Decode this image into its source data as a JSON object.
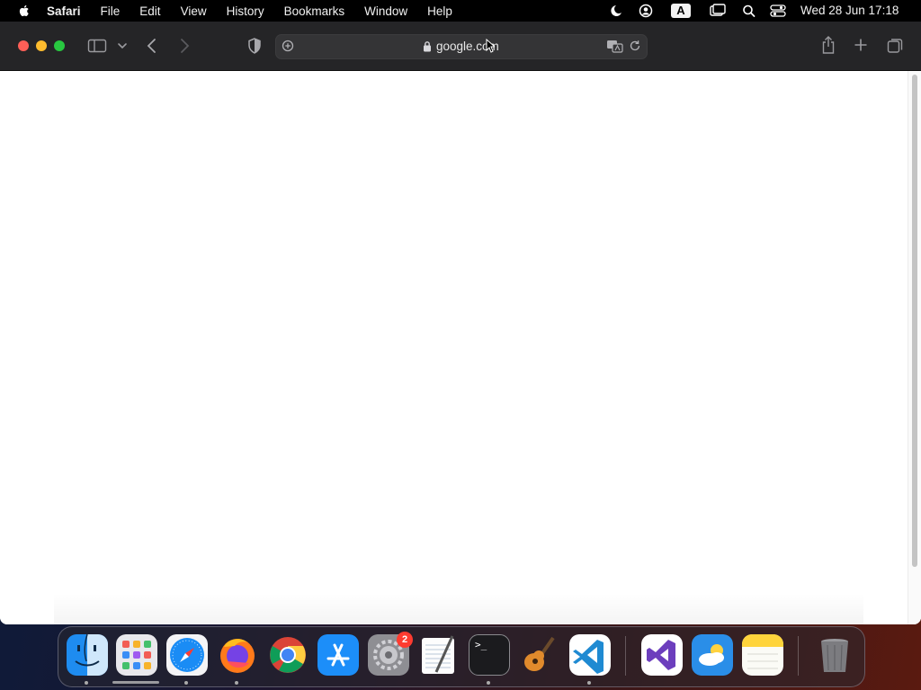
{
  "menubar": {
    "apple_icon": "apple-logo-icon",
    "app_name": "Safari",
    "items": [
      "File",
      "Edit",
      "View",
      "History",
      "Bookmarks",
      "Window",
      "Help"
    ],
    "status_icons": [
      "do-not-disturb-moon-icon",
      "user-account-icon",
      "input-source-A-icon",
      "screen-mirroring-icon",
      "spotlight-search-icon",
      "control-center-icon"
    ],
    "input_source_letter": "A",
    "clock": "Wed 28 Jun  17:18"
  },
  "toolbar": {
    "address": "google.com",
    "icons": [
      "sidebar-icon",
      "chevron-down-icon",
      "back-icon",
      "forward-icon",
      "privacy-shield-icon",
      "page-menu-icon",
      "lock-icon",
      "translate-icon",
      "reload-icon",
      "share-icon",
      "new-tab-icon",
      "tab-overview-icon"
    ]
  },
  "dock": {
    "apps": [
      "Finder",
      "Launchpad",
      "Safari",
      "Firefox",
      "Chrome",
      "App Store",
      "System Settings",
      "TextEdit",
      "Terminal",
      "GarageBand",
      "Visual Studio Code",
      "Visual Studio",
      "Weather",
      "Notes",
      "Trash"
    ],
    "settings_badge": "2",
    "terminal_prompt": ">_"
  },
  "colors": {
    "menubar": "#000000",
    "toolbar": "#252527",
    "close": "#fe5f57",
    "minimize": "#febc2e",
    "maximize": "#28c840",
    "badge": "#ff3b30"
  }
}
